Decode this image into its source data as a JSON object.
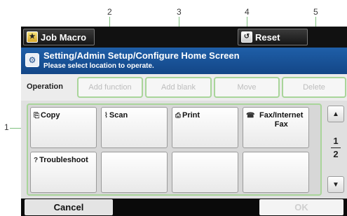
{
  "callouts": [
    "1",
    "2",
    "3",
    "4",
    "5"
  ],
  "topbar": {
    "job_macro": "Job Macro",
    "reset": "Reset"
  },
  "title": {
    "path": "Setting/Admin Setup/Configure Home Screen",
    "subtitle": "Please select location to operate."
  },
  "operation": {
    "label": "Operation",
    "add_function": "Add function",
    "add_blank": "Add blank",
    "move": "Move",
    "delete": "Delete"
  },
  "grid": {
    "cells": [
      {
        "label": "Copy",
        "icon": "copy-icon",
        "glyph": "⎘"
      },
      {
        "label": "Scan",
        "icon": "scan-icon",
        "glyph": "⌇"
      },
      {
        "label": "Print",
        "icon": "print-icon",
        "glyph": "⎙"
      },
      {
        "label": "Fax/Internet Fax",
        "icon": "fax-icon",
        "glyph": "☎"
      },
      {
        "label": "Troubleshoot",
        "icon": "troubleshoot-icon",
        "glyph": "?"
      },
      {
        "label": ""
      },
      {
        "label": ""
      },
      {
        "label": ""
      }
    ]
  },
  "pager": {
    "current": "1",
    "total": "2"
  },
  "bottom": {
    "cancel": "Cancel",
    "ok": "OK"
  }
}
